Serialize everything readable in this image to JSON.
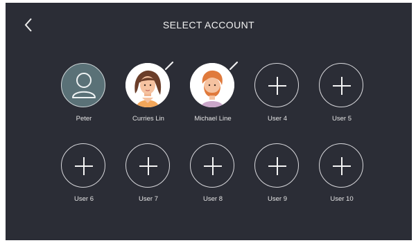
{
  "header": {
    "title": "SELECT ACCOUNT",
    "back_icon": "chevron-left-icon"
  },
  "accounts": [
    {
      "label": "Peter",
      "type": "default-avatar",
      "icon": "user-icon"
    },
    {
      "label": "Curries Lin",
      "type": "photo",
      "icon": "avatar-female",
      "editable": true
    },
    {
      "label": "Michael Line",
      "type": "photo",
      "icon": "avatar-male",
      "editable": true
    },
    {
      "label": "User 4",
      "type": "add",
      "icon": "plus-icon"
    },
    {
      "label": "User 5",
      "type": "add",
      "icon": "plus-icon"
    },
    {
      "label": "User 6",
      "type": "add",
      "icon": "plus-icon"
    },
    {
      "label": "User 7",
      "type": "add",
      "icon": "plus-icon"
    },
    {
      "label": "User 8",
      "type": "add",
      "icon": "plus-icon"
    },
    {
      "label": "User 9",
      "type": "add",
      "icon": "plus-icon"
    },
    {
      "label": "User 10",
      "type": "add",
      "icon": "plus-icon"
    }
  ],
  "colors": {
    "background": "#2b2d36",
    "accent_avatar": "#5a7177",
    "text": "#e6e6e6"
  }
}
